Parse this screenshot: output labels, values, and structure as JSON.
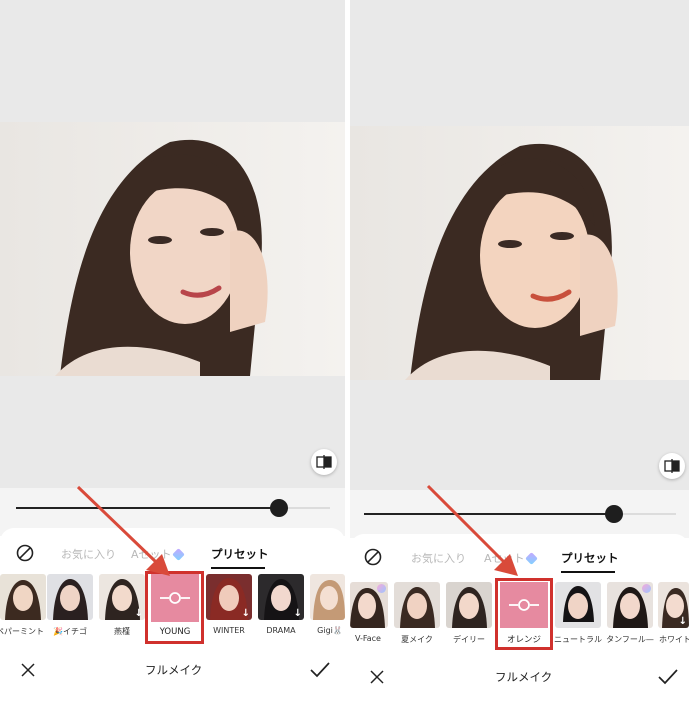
{
  "left": {
    "tabs": {
      "favorites": "お気に入り",
      "avatar": "Aセット",
      "presets": "プリセット"
    },
    "thumbnails": [
      {
        "label": "ペパーミント",
        "download": false
      },
      {
        "label": "🎉イチゴ",
        "download": false
      },
      {
        "label": "燕槿",
        "download": true
      },
      {
        "label": "YOUNG",
        "selected": true
      },
      {
        "label": "WINTER",
        "download": true
      },
      {
        "label": "DRAMA",
        "download": true
      },
      {
        "label": "Gigi🐰",
        "download": false
      }
    ],
    "bottom_title": "フルメイク",
    "slider_value": 0.86
  },
  "right": {
    "tabs": {
      "favorites": "お気に入り",
      "avatar": "Aセット",
      "presets": "プリセット"
    },
    "thumbnails": [
      {
        "label": "V-Face"
      },
      {
        "label": "夏メイク"
      },
      {
        "label": "デイリー"
      },
      {
        "label": "オレンジ",
        "selected": true
      },
      {
        "label": "ニュートラル"
      },
      {
        "label": "タンフール—"
      },
      {
        "label": "ホワイト"
      }
    ],
    "bottom_title": "フルメイク",
    "slider_value": 0.78
  },
  "colors": {
    "highlight": "#d0312d",
    "selected_tile": "#e68aa0",
    "arrow": "#d94a3a"
  }
}
